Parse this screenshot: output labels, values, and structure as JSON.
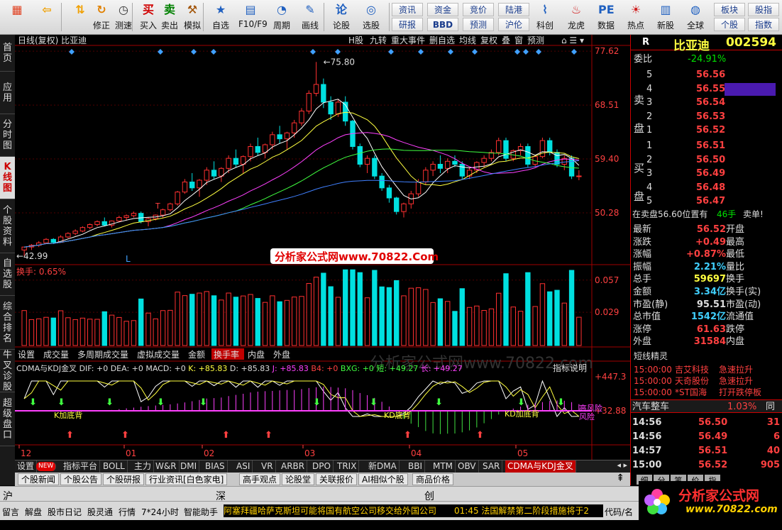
{
  "toolbar": {
    "left": [
      {
        "label": "",
        "icon": "windows-icon"
      },
      {
        "label": "",
        "icon": "back-arrow-icon"
      },
      {
        "label": "",
        "icon": "up-down-arrows-icon"
      },
      {
        "label": "修正",
        "icon": "correction-icon"
      },
      {
        "label": "测速",
        "icon": "clock-icon"
      },
      {
        "label": "买入",
        "icon": "buy-icon",
        "glyph": "买"
      },
      {
        "label": "卖出",
        "icon": "sell-icon",
        "glyph": "卖"
      },
      {
        "label": "模拟",
        "icon": "hammer-icon"
      },
      {
        "label": "自选",
        "icon": "watchlist-icon"
      },
      {
        "label": "F10/F9",
        "icon": "f10-icon"
      },
      {
        "label": "周期",
        "icon": "period-icon"
      },
      {
        "label": "画线",
        "icon": "pencil-icon"
      },
      {
        "label": "论股",
        "icon": "discuss-icon"
      },
      {
        "label": "选股",
        "icon": "screener-icon"
      }
    ],
    "small": [
      [
        "资讯",
        "资金",
        "竞价",
        "陆港"
      ],
      [
        "研报",
        "BBD",
        "预测",
        "沪伦"
      ]
    ],
    "right": [
      {
        "label": "科创",
        "icon": "chart-icon"
      },
      {
        "label": "龙虎",
        "icon": "dragon-icon"
      },
      {
        "label": "数据",
        "icon": "pe-icon"
      },
      {
        "label": "热点",
        "icon": "hot-icon"
      },
      {
        "label": "新股",
        "icon": "ipo-icon"
      },
      {
        "label": "全球",
        "icon": "globe-icon"
      }
    ],
    "small2": [
      [
        "板块",
        "股指"
      ],
      [
        "个股",
        "指数"
      ]
    ]
  },
  "left_tabs": [
    "首页",
    "应用",
    "分时图",
    "K线图",
    "个股资料",
    "自选股",
    "综合排名",
    "牛叉诊股",
    "超级盘口"
  ],
  "chart": {
    "title": "日线(复权)  比亚迪",
    "top_buttons": [
      "H股",
      "九转",
      "重大事件",
      "删自选",
      "均线",
      "复权",
      "叠",
      "窗",
      "预测"
    ],
    "watermark": "分析家公式网www.70822.Com",
    "watermark2": "分析家公式网www.70822.com",
    "price_axis": [
      "77.62",
      "68.51",
      "59.40",
      "50.28"
    ],
    "hi_label": "75.80",
    "lo_label": "42.99",
    "l_label": "L",
    "t_label": "T",
    "vol_title": "换手: 0.65%",
    "vol_axis": [
      "0.057",
      "0.029"
    ],
    "mid_tabs": [
      "设置",
      "成交量",
      "多周期成交量",
      "虚拟成交量",
      "金额",
      "换手率",
      "内盘",
      "外盘"
    ],
    "ind_title_parts": [
      [
        "CDMA与KDJ金叉 DIF: +0 DEA: +0 MACD: +0",
        "#dddddd"
      ],
      [
        " K: +85.83",
        "#ffff40"
      ],
      [
        " D: +85.83",
        "#dddddd"
      ],
      [
        " J: +85.83",
        "#ff40ff"
      ],
      [
        " B4: +0",
        "#ff4040"
      ],
      [
        " BXG: +0",
        "#40ff40"
      ],
      [
        " 短: +49.27",
        "#40ff40"
      ],
      [
        " 长: +49.27",
        "#ff40ff"
      ]
    ],
    "ind_button": "指标说明",
    "ind_axis": [
      "+447.3",
      "+32.88"
    ],
    "ind_labels": [
      "K加底背",
      "KD底背",
      "KD加底背",
      "高风险",
      "风险"
    ],
    "date_axis": [
      "12",
      "01",
      "02",
      "03",
      "04",
      "05"
    ]
  },
  "bottom_tabs": [
    "设置",
    "NEW",
    "指标平台",
    "BOLL",
    "主力",
    "W&R",
    "DMI",
    "BIAS",
    "ASI",
    "VR",
    "ARBR",
    "DPO",
    "TRIX",
    "新DMA",
    "BBI",
    "MTM",
    "OBV",
    "SAR",
    "CDMA与KDJ金叉"
  ],
  "news_tabs": [
    "个股新闻",
    "个股公告",
    "个股研报",
    "行业资讯[白色家电]",
    "高手观点",
    "论股堂",
    "关联报价",
    "AI相似个股",
    "商品价格"
  ],
  "right": {
    "name": "比亚迪",
    "code": "002594",
    "r": "R",
    "webi": {
      "label": "委比",
      "value": "-24.91%"
    },
    "sell_label": "卖盘",
    "buy_label": "买盘",
    "sells": [
      [
        "5",
        "56.56"
      ],
      [
        "4",
        "56.55"
      ],
      [
        "3",
        "56.54"
      ],
      [
        "2",
        "56.53"
      ],
      [
        "1",
        "56.52"
      ]
    ],
    "buys": [
      [
        "1",
        "56.51"
      ],
      [
        "2",
        "56.50"
      ],
      [
        "3",
        "56.49"
      ],
      [
        "4",
        "56.48"
      ],
      [
        "5",
        "56.47"
      ]
    ],
    "sell_msg": {
      "text": "在卖盘56.60位置有",
      "count": "46手",
      "tail": "卖单!"
    },
    "quotes": [
      [
        "最新",
        "56.52",
        "开盘",
        ""
      ],
      [
        "涨跌",
        "+0.49",
        "最高",
        ""
      ],
      [
        "涨幅",
        "+0.87%",
        "最低",
        ""
      ],
      [
        "振幅",
        "2.21%",
        "量比",
        ""
      ],
      [
        "总手",
        "59697",
        "换手",
        ""
      ],
      [
        "金额",
        "3.34亿",
        "换手(实)",
        ""
      ],
      [
        "市盈(静)",
        "95.51",
        "市盈(动)",
        ""
      ],
      [
        "总市值",
        "1542亿",
        "流通值",
        ""
      ],
      [
        "涨停",
        "61.63",
        "跌停",
        ""
      ],
      [
        "外盘",
        "31584",
        "内盘",
        ""
      ]
    ],
    "quote_colors": [
      "#ff4040",
      "#ff4040",
      "#ff4040",
      "#40d0ff",
      "#ffff40",
      "#40d0ff",
      "#dddddd",
      "#40d0ff",
      "#ff4040",
      "#ff4040"
    ],
    "sprite_title": "短线精灵",
    "sprites": [
      [
        "15:00:00",
        "吉艾科技",
        "急速拉升"
      ],
      [
        "15:00:00",
        "天奇股份",
        "急速拉升"
      ],
      [
        "15:00:00",
        "*ST国海",
        "打开跌停板"
      ]
    ],
    "sector": {
      "name": "汽车整车",
      "pct": "1.03%",
      "extra": "同"
    },
    "ticks": [
      [
        "14:56",
        "56.50",
        "31"
      ],
      [
        "14:56",
        "56.49",
        "6"
      ],
      [
        "14:57",
        "56.51",
        "40"
      ],
      [
        "15:00",
        "56.52",
        "905"
      ]
    ],
    "bottom_tabs": [
      "细",
      "分",
      "笔",
      "价",
      "指"
    ]
  },
  "status1": {
    "sh": "沪",
    "sz": "深",
    "cy": "创"
  },
  "status2": {
    "items": [
      "留言",
      "解盘",
      "股市日记",
      "股灵通",
      "行情",
      "7*24小时",
      "智能助手"
    ],
    "headline": "阿塞拜疆哈萨克斯坦可能将国有航空公司移交给外国公司",
    "time_news": "01:45 法国解禁第二阶段措施将于2",
    "code_label": "代码/名称"
  },
  "logo": {
    "text": "分析家公式网",
    "url": "www.70822.com"
  },
  "colors": {
    "up": "#ff3030",
    "down": "#00e0e0",
    "bg": "#000000"
  },
  "chart_data": {
    "type": "candlestick",
    "candles": [
      [
        44,
        44.5,
        43,
        44.5
      ],
      [
        44.5,
        45,
        44,
        44.8
      ],
      [
        44.8,
        45.5,
        44.5,
        45.2
      ],
      [
        45.2,
        46,
        45,
        45.8
      ],
      [
        45.8,
        46,
        45,
        45.3
      ],
      [
        45.3,
        46.5,
        45.2,
        46.2
      ],
      [
        46.2,
        47,
        46,
        46.8
      ],
      [
        46.8,
        47.5,
        46.5,
        47.2
      ],
      [
        47.2,
        48,
        47,
        47.8
      ],
      [
        47.8,
        48.5,
        47.5,
        48.3
      ],
      [
        48.3,
        49,
        48,
        48.8
      ],
      [
        48.8,
        49.5,
        48,
        48.2
      ],
      [
        48.2,
        49,
        47.8,
        48.9
      ],
      [
        48.9,
        49.8,
        48.7,
        49.5
      ],
      [
        49.5,
        50,
        49,
        49.8
      ],
      [
        49.8,
        50.5,
        49.5,
        50.2
      ],
      [
        50.2,
        50.5,
        48.5,
        48.8
      ],
      [
        48.8,
        49.5,
        48,
        49.3
      ],
      [
        49.3,
        50,
        49,
        49.9
      ],
      [
        49.9,
        51,
        49.5,
        50.8
      ],
      [
        50.8,
        52,
        50.5,
        51.8
      ],
      [
        51.8,
        54,
        51.5,
        53.8
      ],
      [
        53.8,
        56,
        53.5,
        55.5
      ],
      [
        55.5,
        57,
        54,
        54.5
      ],
      [
        54.5,
        56,
        53,
        55.8
      ],
      [
        55.8,
        58,
        55,
        57.5
      ],
      [
        57.5,
        59,
        56,
        56.5
      ],
      [
        56.5,
        58,
        55.5,
        57.8
      ],
      [
        57.8,
        60,
        57,
        59.5
      ],
      [
        59.5,
        61,
        58,
        58.5
      ],
      [
        58.5,
        60,
        57,
        59.8
      ],
      [
        59.8,
        62,
        59,
        61.5
      ],
      [
        61.5,
        63,
        60,
        60.5
      ],
      [
        60.5,
        62,
        59.5,
        61.8
      ],
      [
        61.8,
        64,
        61,
        63.5
      ],
      [
        63.5,
        65,
        62,
        62.8
      ],
      [
        62.8,
        64,
        61,
        63.8
      ],
      [
        63.8,
        66,
        63,
        65.5
      ],
      [
        65.5,
        68,
        65,
        67.5
      ],
      [
        67.5,
        71,
        67,
        70.5
      ],
      [
        70.5,
        75.8,
        70,
        72
      ],
      [
        72,
        73,
        68,
        69
      ],
      [
        69,
        70,
        66,
        67
      ],
      [
        67,
        69.5,
        66.5,
        69
      ],
      [
        69,
        70,
        65,
        65.8
      ],
      [
        65.8,
        66,
        61,
        61.5
      ],
      [
        61.5,
        62,
        58,
        58.5
      ],
      [
        58.5,
        60,
        57,
        59.5
      ],
      [
        59.5,
        60,
        56,
        56.5
      ],
      [
        56.5,
        57,
        54,
        54.5
      ],
      [
        54.5,
        55,
        52,
        52.8
      ],
      [
        52.8,
        53,
        50,
        50.5
      ],
      [
        50.5,
        52,
        49.5,
        51.8
      ],
      [
        51.8,
        54,
        51,
        53.5
      ],
      [
        53.5,
        56,
        53,
        55.5
      ],
      [
        55.5,
        58,
        55,
        57.5
      ],
      [
        57.5,
        59,
        56.5,
        58.5
      ],
      [
        58.5,
        60,
        57,
        57.8
      ],
      [
        57.8,
        59.5,
        57,
        59
      ],
      [
        59,
        60,
        58,
        58.5
      ],
      [
        58.5,
        59,
        56,
        56.5
      ],
      [
        56.5,
        58,
        56,
        57.5
      ],
      [
        57.5,
        59,
        57,
        58.8
      ],
      [
        58.8,
        60,
        58,
        59.5
      ],
      [
        59.5,
        61,
        59,
        60.5
      ],
      [
        60.5,
        63,
        60,
        62.5
      ],
      [
        62.5,
        63,
        59,
        59.5
      ],
      [
        59.5,
        61,
        59,
        60.8
      ],
      [
        60.8,
        62,
        60,
        61.5
      ],
      [
        61.5,
        62,
        58,
        58.5
      ],
      [
        58.5,
        60,
        58,
        59.8
      ],
      [
        59.8,
        63,
        59.5,
        62.5
      ],
      [
        62.5,
        63,
        60,
        60.5
      ],
      [
        60.5,
        61,
        58,
        58.5
      ],
      [
        58.5,
        60,
        57.5,
        59.5
      ],
      [
        59.5,
        60,
        56,
        56.5
      ],
      [
        56.5,
        57.5,
        55.8,
        56.52
      ]
    ],
    "hi": 75.8,
    "lo": 42.99,
    "ylim": [
      42,
      78
    ]
  }
}
